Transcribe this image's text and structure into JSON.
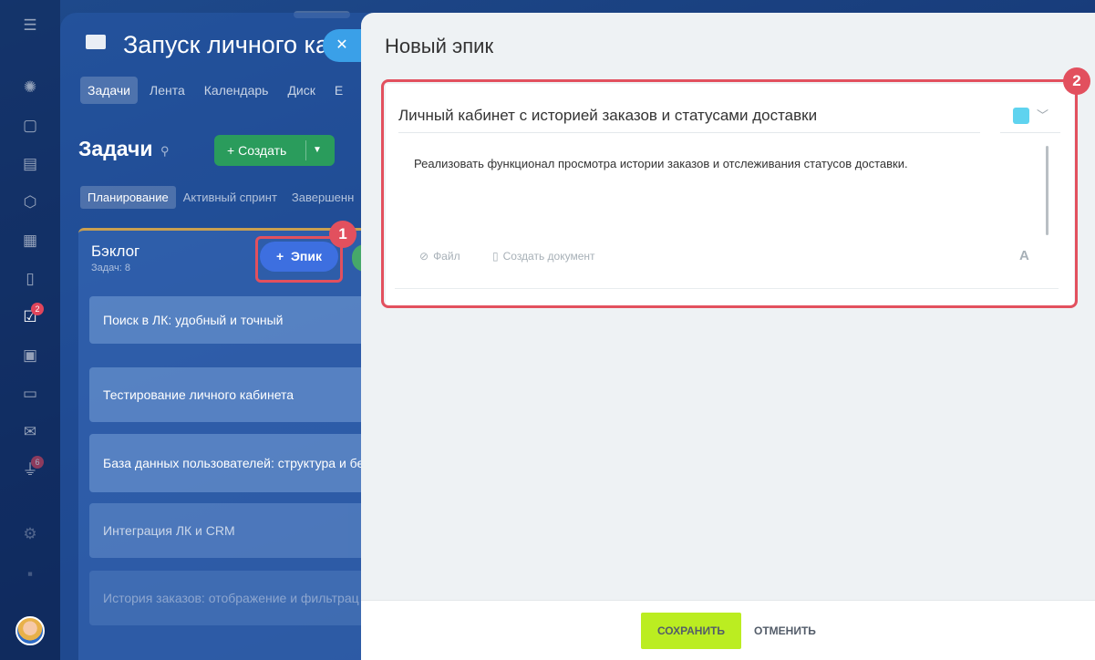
{
  "rail": {
    "icons": [
      "menu-icon",
      "activity-icon",
      "chat-icon",
      "feed-icon",
      "hexagon-icon",
      "calendar-icon",
      "document-icon",
      "tasks-icon",
      "presentation-icon",
      "crm-icon",
      "mail-icon",
      "funnel-icon",
      "settings-icon",
      "widget-icon"
    ],
    "tasks_badge": "2",
    "funnel_badge": "6"
  },
  "project": {
    "title": "Запуск личного ка",
    "tabs": [
      "Задачи",
      "Лента",
      "Календарь",
      "Диск",
      "Е"
    ]
  },
  "tasks_section": {
    "title": "Задачи",
    "create_label": "Создать",
    "subtabs": [
      "Планирование",
      "Активный спринт",
      "Завершенн"
    ]
  },
  "backlog": {
    "title": "Бэклог",
    "count": "Задач: 8",
    "epic_button": "Эпик",
    "tasks": [
      "Поиск в ЛК: удобный и точный",
      "Тестирование личного кабинета",
      "База данных пользователей: структура и без",
      "Интеграция ЛК и CRM",
      "История заказов: отображение и фильтрац"
    ]
  },
  "markers": {
    "one": "1",
    "two": "2"
  },
  "slider": {
    "title": "Новый эпик",
    "name_value": "Личный кабинет с историей заказов и статусами доставки",
    "color": "#5fd3ef",
    "description": "Реализовать функционал просмотра истории заказов и отслеживания статусов доставки.",
    "file_label": "Файл",
    "create_doc_label": "Создать документ",
    "font_label": "A"
  },
  "footer": {
    "save_label": "СОХРАНИТЬ",
    "cancel_label": "ОТМЕНИТЬ"
  },
  "colors": {
    "highlight": "#e2505e",
    "save_button": "#bbed21",
    "epic_button": "#3d6fe0"
  }
}
